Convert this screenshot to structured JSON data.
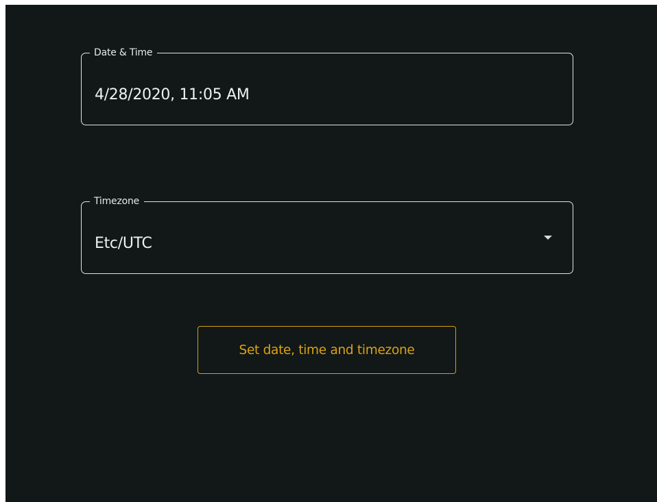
{
  "datetime_field": {
    "label": "Date & Time",
    "value": "4/28/2020, 11:05 AM"
  },
  "timezone_field": {
    "label": "Timezone",
    "value": "Etc/UTC",
    "caret_icon": "caret-down-icon"
  },
  "submit_button": {
    "label": "Set date, time and timezone"
  },
  "colors": {
    "background": "#121717",
    "field_border": "#e2e5e5",
    "text": "#eef1f1",
    "accent": "#d9a112"
  }
}
